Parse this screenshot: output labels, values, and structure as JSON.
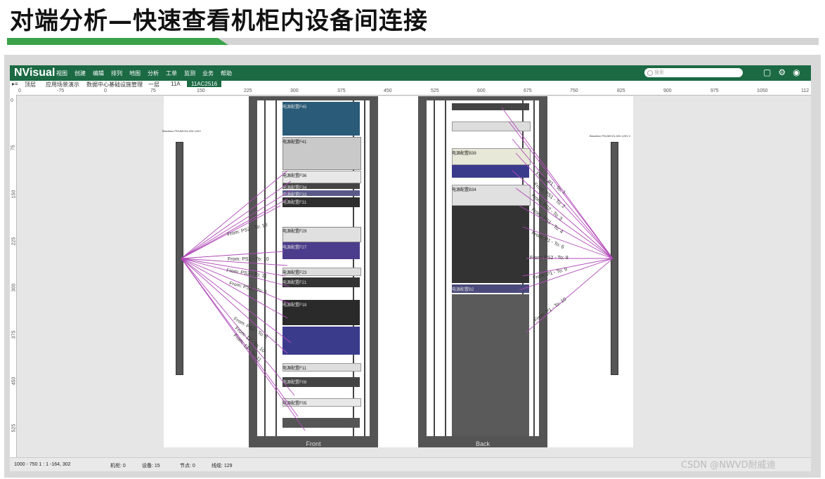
{
  "slide": {
    "title": "对端分析—快速查看机柜内设备间连接"
  },
  "app": {
    "logo": "NVisual",
    "menu": [
      "视图",
      "创建",
      "编辑",
      "排列",
      "地图",
      "分析",
      "工单",
      "监测",
      "业务",
      "帮助"
    ],
    "search_placeholder": "搜索",
    "icons": [
      "chat-icon",
      "settings-icon",
      "user-icon"
    ]
  },
  "breadcrumb": [
    "顶层",
    "应用场景演示",
    "数据中心基础设施管理",
    "一层",
    "11A",
    "11AC2516"
  ],
  "ruler": {
    "h_ticks": [
      "0",
      "-75",
      "0",
      "75",
      "150",
      "225",
      "300",
      "375",
      "450",
      "525",
      "600",
      "675",
      "750",
      "825",
      "900",
      "975",
      "1050",
      "112"
    ],
    "v_ticks": [
      "0",
      "75",
      "150",
      "225",
      "300",
      "375",
      "450",
      "525"
    ]
  },
  "pdu": {
    "left_label": "Blackbox PDUMV24-020-120V",
    "right_label": "Blackbox PDUMV24-020-120V 2"
  },
  "racks": [
    {
      "label": "Front",
      "devices": [
        "电源配置F45",
        "电源配置F41",
        "电源配置F36",
        "电源配置F34",
        "电源配置F33",
        "电源配置F31",
        "电源配置F29",
        "电源配置F27",
        "电源配置F23",
        "电源配置F21",
        "电源配置F18",
        "电源配置F11",
        "电源配置F08",
        "电源配置F05"
      ]
    },
    {
      "label": "Back",
      "devices": [
        "电源配置B39",
        "电源配置B34",
        "电源配置B2"
      ]
    }
  ],
  "connections": {
    "left": [
      "From: PS2 - To: 18",
      "From: PS1 - To: 10",
      "From: PS2 - To: 11",
      "From: PS2 - To: 6",
      "From: PS2 - To: 8",
      "From: 12 - To: 10",
      "From: 13 - To: 11"
    ],
    "right": [
      "From: P1 - To: 1",
      "From: PS1 - To: 2",
      "From: PS2 - To: 3",
      "From: PS1 - To: 4",
      "From: P1 - To: 6",
      "From: PS2 - To: 8",
      "From: P1 - To: 9",
      "From: P1 - To: 10"
    ]
  },
  "status": {
    "coords": "1000 - 750  1 : 1   -164, 302",
    "racks": "机柜: 0",
    "devices": "设备: 15",
    "nodes": "节点: 0",
    "links": "线缆: 129"
  },
  "watermark": "CSDN @NWVD耐威迪",
  "colors": {
    "brand": "#1b6a44",
    "link": "#b04ab8",
    "accent_green": "#6cbd2e"
  }
}
